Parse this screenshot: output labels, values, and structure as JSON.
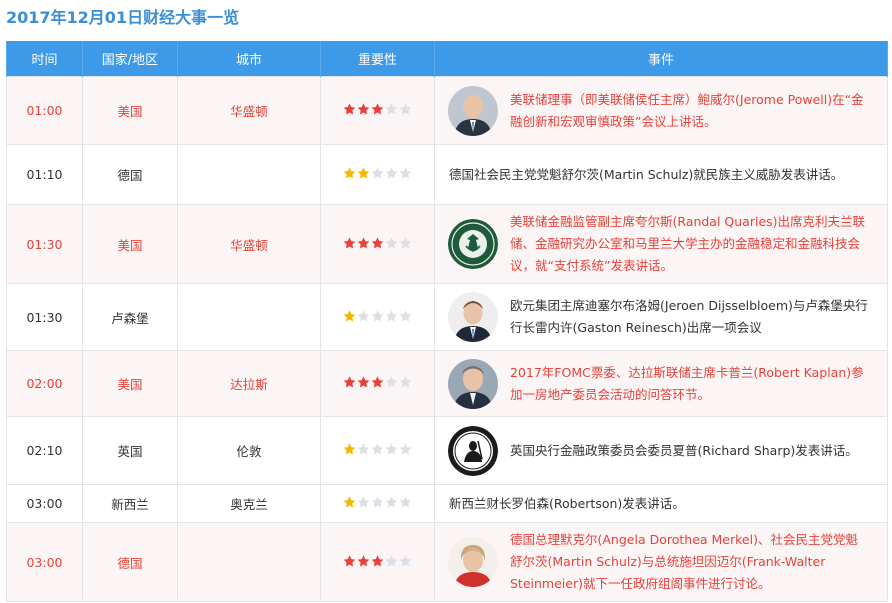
{
  "page": {
    "title": "2017年12月01日财经大事一览"
  },
  "table": {
    "headers": {
      "time": "时间",
      "country": "国家/地区",
      "city": "城市",
      "importance": "重要性",
      "event": "事件"
    },
    "colors": {
      "header_bg": "#3d9ae8",
      "important_text": "#e8413a",
      "important_row_bg": "#fbf5f5",
      "star_red": "#e8413a",
      "star_gold": "#f5b800",
      "star_empty": "#dcdfe6"
    },
    "rows": [
      {
        "time": "01:00",
        "country": "美国",
        "city": "华盛顿",
        "stars": 3,
        "highlight": true,
        "avatar": "jerome-powell-portrait",
        "event": "美联储理事（即美联储侯任主席）鲍威尔(Jerome Powell)在“金融创新和宏观审慎政策”会议上讲话。"
      },
      {
        "time": "01:10",
        "country": "德国",
        "city": "",
        "stars": 2,
        "highlight": false,
        "avatar": "",
        "event": "德国社会民主党党魁舒尔茨(Martin Schulz)就民族主义威胁发表讲话。"
      },
      {
        "time": "01:30",
        "country": "美国",
        "city": "华盛顿",
        "stars": 3,
        "highlight": true,
        "avatar": "federal-reserve-seal",
        "event": "美联储金融监管副主席夸尔斯(Randal Quarles)出席克利夫兰联储、金融研究办公室和马里兰大学主办的金融稳定和金融科技会议，就“支付系统”发表讲话。"
      },
      {
        "time": "01:30",
        "country": "卢森堡",
        "city": "",
        "stars": 1,
        "highlight": false,
        "avatar": "jeroen-dijsselbloem-portrait",
        "event": "欧元集团主席迪塞尔布洛姆(Jeroen Dijsselbloem)与卢森堡央行行长雷内许(Gaston Reinesch)出席一项会议"
      },
      {
        "time": "02:00",
        "country": "美国",
        "city": "达拉斯",
        "stars": 3,
        "highlight": true,
        "avatar": "robert-kaplan-portrait",
        "event": "2017年FOMC票委、达拉斯联储主席卡普兰(Robert Kaplan)参加一房地产委员会活动的问答环节。"
      },
      {
        "time": "02:10",
        "country": "英国",
        "city": "伦敦",
        "stars": 1,
        "highlight": false,
        "avatar": "bank-of-england-logo",
        "event": "英国央行金融政策委员会委员夏普(Richard Sharp)发表讲话。"
      },
      {
        "time": "03:00",
        "country": "新西兰",
        "city": "奥克兰",
        "stars": 1,
        "highlight": false,
        "avatar": "",
        "event": "新西兰财长罗伯森(Robertson)发表讲话。"
      },
      {
        "time": "03:00",
        "country": "德国",
        "city": "",
        "stars": 3,
        "highlight": true,
        "avatar": "angela-merkel-portrait",
        "event": "德国总理默克尔(Angela Dorothea Merkel)、社会民主党党魁舒尔茨(Martin Schulz)与总统施坦因迈尔(Frank-Walter Steinmeier)就下一任政府组阁事件进行讨论。"
      }
    ]
  }
}
